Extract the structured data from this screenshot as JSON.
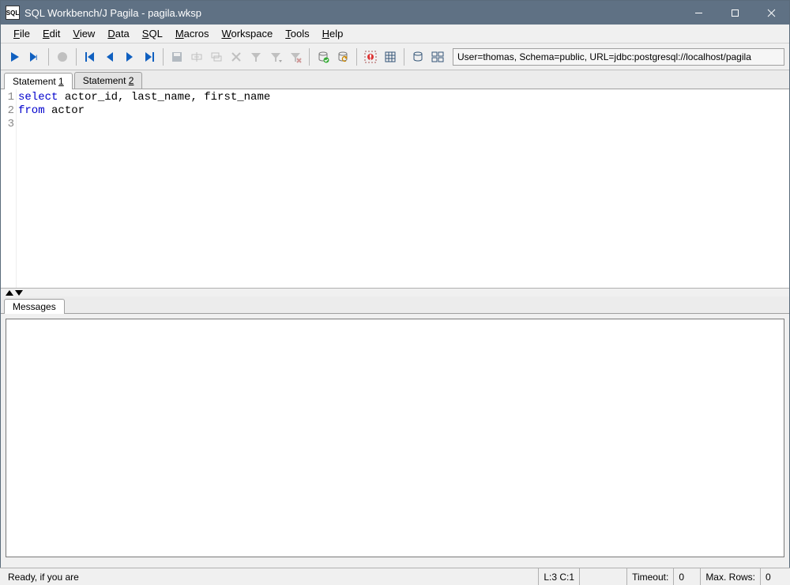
{
  "title": "SQL Workbench/J Pagila - pagila.wksp",
  "menu": {
    "file": "File",
    "edit": "Edit",
    "view": "View",
    "data": "Data",
    "sql": "SQL",
    "macros": "Macros",
    "workspace": "Workspace",
    "tools": "Tools",
    "help": "Help"
  },
  "connection_info": "User=thomas, Schema=public, URL=jdbc:postgresql://localhost/pagila",
  "tabs": [
    "Statement 1",
    "Statement 2"
  ],
  "active_tab": 0,
  "editor": {
    "lines": [
      "1",
      "2",
      "3"
    ],
    "code": {
      "l1_kw": "select",
      "l1_rest": " actor_id, last_name, first_name",
      "l2_kw": "from",
      "l2_rest": " actor"
    }
  },
  "messages_tab": "Messages",
  "status": {
    "ready": "Ready, if you are",
    "cursor": "L:3 C:1",
    "timeout_label": "Timeout:",
    "timeout_value": "0",
    "maxrows_label": "Max. Rows:",
    "maxrows_value": "0"
  }
}
